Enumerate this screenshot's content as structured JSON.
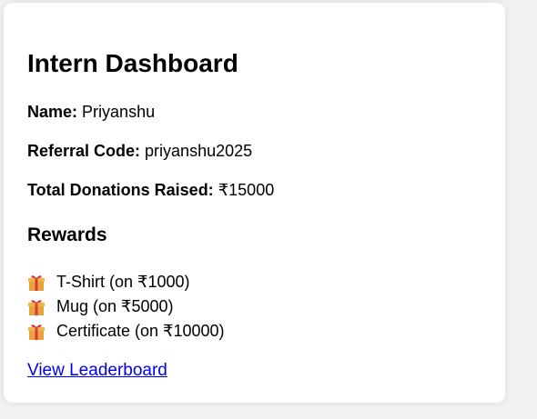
{
  "dashboard": {
    "title": "Intern Dashboard",
    "name_label": "Name:",
    "name_value": "Priyanshu",
    "referral_label": "Referral Code:",
    "referral_value": "priyanshu2025",
    "donations_label": "Total Donations Raised:",
    "donations_value": "₹15000"
  },
  "rewards": {
    "heading": "Rewards",
    "items": [
      {
        "icon": "gift-icon",
        "label": "T-Shirt (on ₹1000)"
      },
      {
        "icon": "gift-icon",
        "label": "Mug (on ₹5000)"
      },
      {
        "icon": "gift-icon",
        "label": "Certificate (on ₹10000)"
      }
    ]
  },
  "links": {
    "leaderboard": "View Leaderboard"
  },
  "colors": {
    "link": "#0000ee",
    "gift_box": "#e8a33a",
    "gift_ribbon": "#d93b3b"
  }
}
